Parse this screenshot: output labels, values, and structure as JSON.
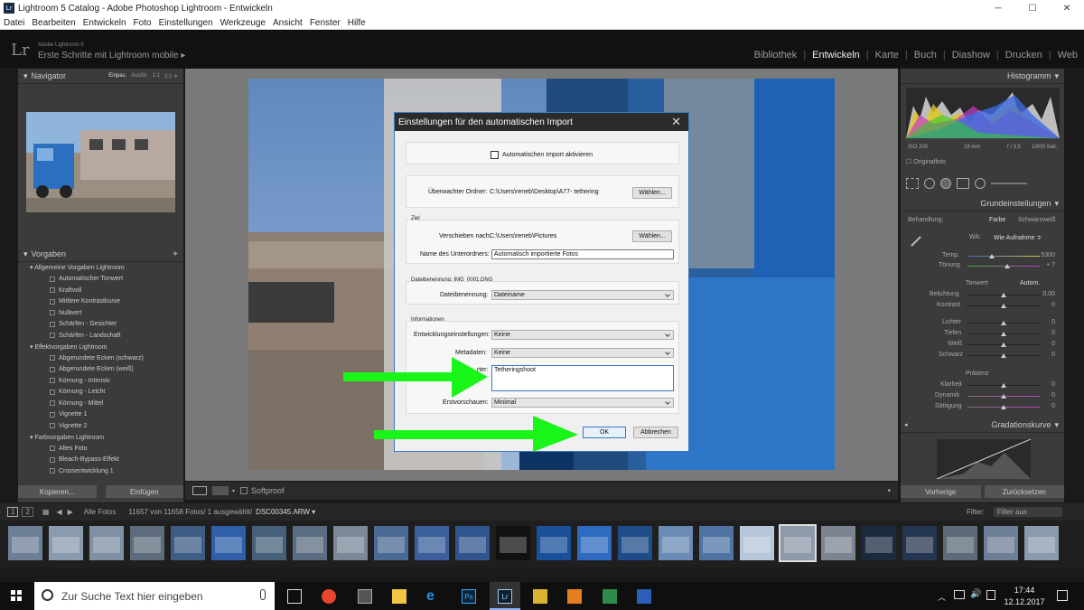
{
  "window": {
    "title": "Lightroom 5 Catalog - Adobe Photoshop Lightroom - Entwickeln",
    "app_icon": "Lr"
  },
  "menu": [
    "Datei",
    "Bearbeiten",
    "Entwickeln",
    "Foto",
    "Einstellungen",
    "Werkzeuge",
    "Ansicht",
    "Fenster",
    "Hilfe"
  ],
  "identity": {
    "logo": "Lr",
    "small": "Adobe Lightroom 5",
    "main": "Erste Schritte mit Lightroom mobile ▸"
  },
  "modules": [
    "Bibliothek",
    "Entwickeln",
    "Karte",
    "Buch",
    "Diashow",
    "Drucken",
    "Web"
  ],
  "active_module": "Entwickeln",
  "navigator": {
    "title": "Navigator",
    "zoom": [
      "Einpas.",
      "Ausfül.",
      "1:1",
      "3:1 ≑"
    ]
  },
  "presets": {
    "title": "Vorgaben",
    "add": "+",
    "items": [
      {
        "t": "grp",
        "label": "▾  Allgemeine Vorgaben Lightroom"
      },
      {
        "t": "itm",
        "label": "Automatischer Tonwert"
      },
      {
        "t": "itm",
        "label": "Kraftvoll"
      },
      {
        "t": "itm",
        "label": "Mittlere Kontrastkurve"
      },
      {
        "t": "itm",
        "label": "Nullwert"
      },
      {
        "t": "itm",
        "label": "Schärfen - Gesichter"
      },
      {
        "t": "itm",
        "label": "Schärfen - Landschaft"
      },
      {
        "t": "grp",
        "label": "▾  Effektvorgaben Lightroom"
      },
      {
        "t": "itm",
        "label": "Abgerundete Ecken (schwarz)"
      },
      {
        "t": "itm",
        "label": "Abgerundete Ecken (weiß)"
      },
      {
        "t": "itm",
        "label": "Körnung - Intensiv"
      },
      {
        "t": "itm",
        "label": "Körnung - Leicht"
      },
      {
        "t": "itm",
        "label": "Körnung - Mittel"
      },
      {
        "t": "itm",
        "label": "Vignette 1"
      },
      {
        "t": "itm",
        "label": "Vignette 2"
      },
      {
        "t": "grp",
        "label": "▾  Farbvorgaben Lightroom"
      },
      {
        "t": "itm",
        "label": "Altes Foto"
      },
      {
        "t": "itm",
        "label": "Bleach-Bypass-Effekt"
      },
      {
        "t": "itm",
        "label": "Crossentwicklung 1"
      }
    ]
  },
  "left_buttons": {
    "copy": "Kopieren...",
    "paste": "Einfügen"
  },
  "toolbar": {
    "softproof": "Softproof"
  },
  "histogram": {
    "title": "Histogramm",
    "iso": "ISO 200",
    "focal": "18 mm",
    "aperture": "f / 3,5",
    "shutter": "1/800 Sek.",
    "original": "Originalfoto"
  },
  "basic": {
    "title": "Grundeinstellungen",
    "treatment_label": "Behandlung:",
    "color": "Farbe",
    "bw": "Schwarzweiß",
    "wb_label": "WA:",
    "wb_value": "Wie Aufnahme ≑",
    "temp_label": "Temp.",
    "temp": "5300",
    "tint_label": "Tönung",
    "tint": "+ 7",
    "tone_label": "Tonwert",
    "auto": "Autom.",
    "exposure_label": "Belichtung",
    "exposure": "0,00",
    "contrast_label": "Kontrast",
    "contrast": "0",
    "highlights_label": "Lichter",
    "highlights": "0",
    "shadows_label": "Tiefen",
    "shadows": "0",
    "whites_label": "Weiß",
    "whites": "0",
    "blacks_label": "Schwarz",
    "blacks": "0",
    "presence_label": "Präsenz",
    "clarity_label": "Klarheit",
    "clarity": "0",
    "vibrance_label": "Dynamik",
    "vibrance": "0",
    "saturation_label": "Sättigung",
    "saturation": "0"
  },
  "curve": {
    "title": "Gradationskurve"
  },
  "right_buttons": {
    "prev": "Vorherige",
    "reset": "Zurücksetzen"
  },
  "filmbar": {
    "source": "Alle Fotos",
    "count": "11657 von 11658 Fotos/ 1 ausgewählt/",
    "file": "DSC00345.ARW ▾",
    "filter_label": "Filter:",
    "filter_value": "Filter aus"
  },
  "dialog": {
    "title": "Einstellungen für den automatischen Import",
    "enable_label": "Automatischen Import aktivieren",
    "watched_label": "Überwachter Ordner:",
    "watched_value": "C:\\Users\\reneb\\Desktop\\A77- tethering",
    "choose": "Wählen...",
    "dest_section": "Ziel",
    "move_label": "Verschieben nach:",
    "move_value": "C:\\Users\\reneb\\Pictures",
    "sub_label": "Name des Unterordners:",
    "sub_value": "Automatisch importierte Fotos",
    "naming_section": "Dateibenennung: IMG_0001.DNG",
    "naming_label": "Dateibenennung:",
    "naming_value": "Dateiname",
    "info_section": "Informationen",
    "dev_label": "Entwicklungseinstellungen:",
    "dev_value": "Keine",
    "meta_label": "Metadaten:",
    "meta_value": "Keine",
    "kw_label": "rter:",
    "kw_value": "Tetheringshoot",
    "preview_label": "Erstvorschauen:",
    "preview_value": "Minimal",
    "ok": "OK",
    "cancel": "Abbrechen"
  },
  "taskbar": {
    "search": "Zur Suche Text hier eingeben",
    "time": "17:44",
    "date": "12.12.2017"
  },
  "colors": {
    "accent": "#3a78c2",
    "arrow": "#19f519",
    "panel": "#3b3b3b"
  }
}
